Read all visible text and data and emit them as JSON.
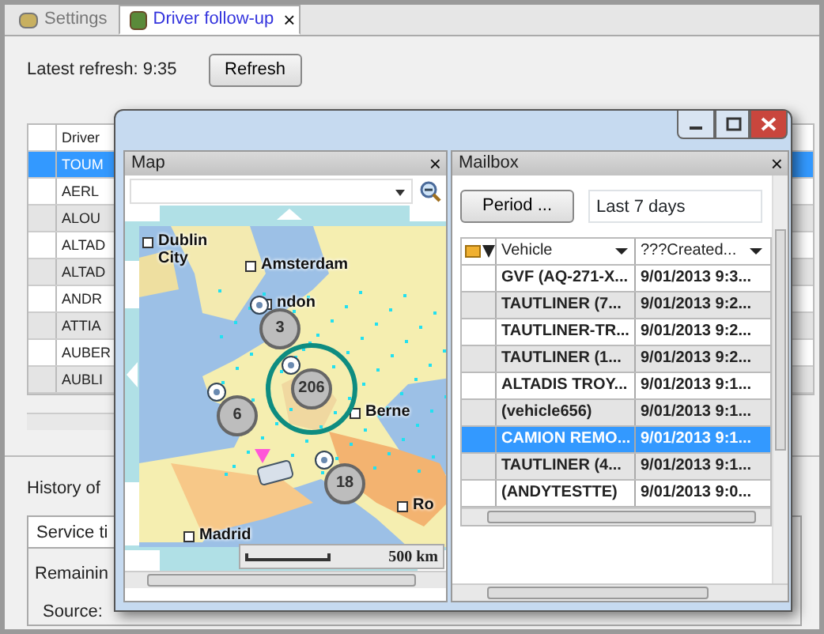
{
  "tabs": [
    {
      "label": "Settings",
      "selected": false,
      "closable": false
    },
    {
      "label": "Driver follow-up",
      "selected": true,
      "closable": true
    }
  ],
  "tab_close": "×",
  "refresh": {
    "label": "Latest refresh: 9:35",
    "button": "Refresh"
  },
  "drivers": {
    "columns": [
      "Driver"
    ],
    "rows": [
      {
        "name": "TOUM",
        "selected": true
      },
      {
        "name": "AERL",
        "selected": false
      },
      {
        "name": "ALOU",
        "selected": false
      },
      {
        "name": "ALTAD",
        "selected": false
      },
      {
        "name": "ALTAD",
        "selected": false
      },
      {
        "name": "ANDR",
        "selected": false
      },
      {
        "name": "ATTIA",
        "selected": false
      },
      {
        "name": "AUBER",
        "selected": false
      },
      {
        "name": "AUBLI",
        "selected": false
      }
    ]
  },
  "history": {
    "title": "History of",
    "tab": "Service ti",
    "fields": [
      "Remainin",
      "Source:"
    ]
  },
  "map": {
    "title": "Map",
    "close": "×",
    "places": [
      "Dublin City",
      "Amsterdam",
      "ndon",
      "Berne",
      "Madrid",
      "Ro"
    ],
    "clusters": [
      {
        "count": "3",
        "selected": false
      },
      {
        "count": "206",
        "selected": true
      },
      {
        "count": "6",
        "selected": false
      },
      {
        "count": "18",
        "selected": false
      }
    ],
    "scale": "500 km"
  },
  "mailbox": {
    "title": "Mailbox",
    "close": "×",
    "period_button": "Period ...",
    "period_value": "Last 7 days",
    "columns": [
      "Vehicle",
      "???Created..."
    ],
    "rows": [
      {
        "vehicle": "GVF (AQ-271-X...",
        "created": "9/01/2013 9:3...",
        "selected": false
      },
      {
        "vehicle": "TAUTLINER (7...",
        "created": "9/01/2013 9:2...",
        "selected": false
      },
      {
        "vehicle": "TAUTLINER-TR...",
        "created": "9/01/2013 9:2...",
        "selected": false
      },
      {
        "vehicle": "TAUTLINER (1...",
        "created": "9/01/2013 9:2...",
        "selected": false
      },
      {
        "vehicle": "ALTADIS TROY...",
        "created": "9/01/2013 9:1...",
        "selected": false
      },
      {
        "vehicle": "(vehicle656)",
        "created": "9/01/2013 9:1...",
        "selected": false
      },
      {
        "vehicle": "CAMION REMO...",
        "created": "9/01/2013 9:1...",
        "selected": true
      },
      {
        "vehicle": "TAUTLINER (4...",
        "created": "9/01/2013 9:1...",
        "selected": false
      },
      {
        "vehicle": "(ANDYTESTTE)",
        "created": "9/01/2013 9:0...",
        "selected": false
      }
    ]
  }
}
